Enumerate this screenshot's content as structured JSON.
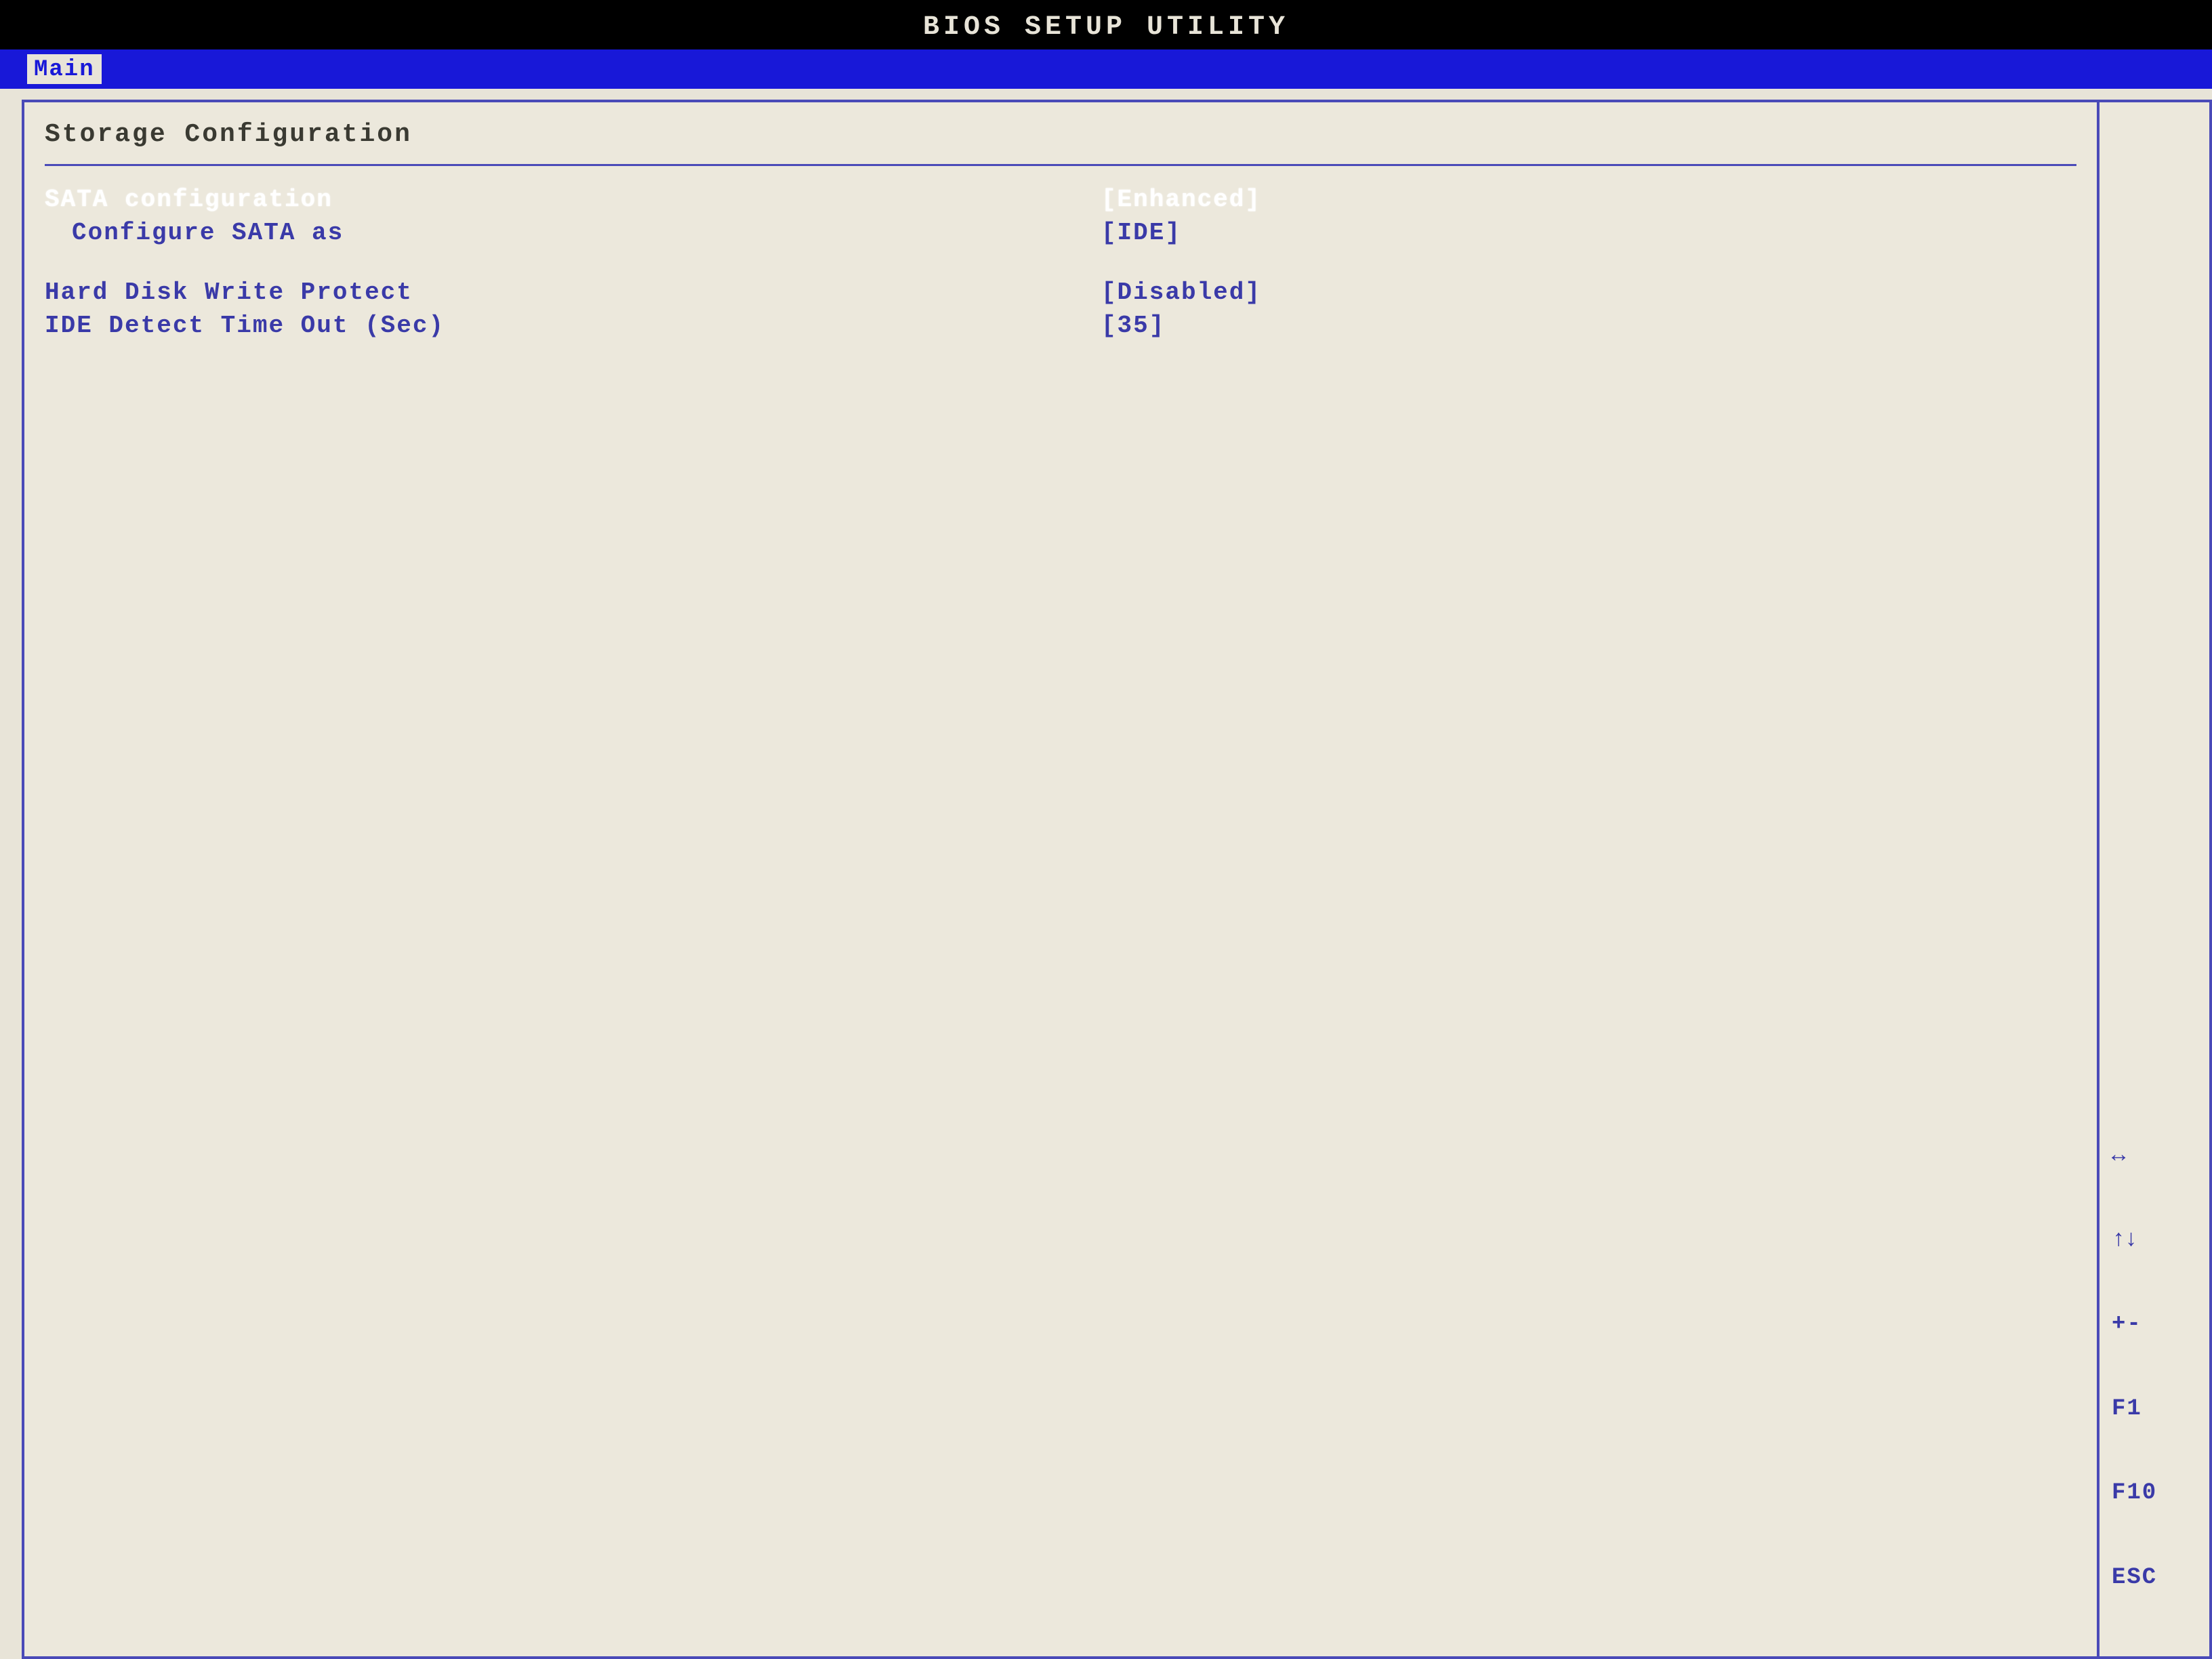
{
  "title": "BIOS SETUP UTILITY",
  "tab": "Main",
  "section": "Storage Configuration",
  "rows": [
    {
      "label": "SATA configuration",
      "value": "[Enhanced]",
      "selected": true,
      "indent": false
    },
    {
      "label": "Configure SATA as",
      "value": "[IDE]",
      "selected": false,
      "indent": true
    },
    {
      "label": "Hard Disk Write Protect",
      "value": "[Disabled]",
      "selected": false,
      "indent": false
    },
    {
      "label": "IDE Detect Time Out (Sec)",
      "value": "[35]",
      "selected": false,
      "indent": false
    }
  ],
  "help": {
    "keys": [
      "↔",
      "↑↓",
      "+-",
      "F1",
      "F10",
      "ESC"
    ]
  }
}
